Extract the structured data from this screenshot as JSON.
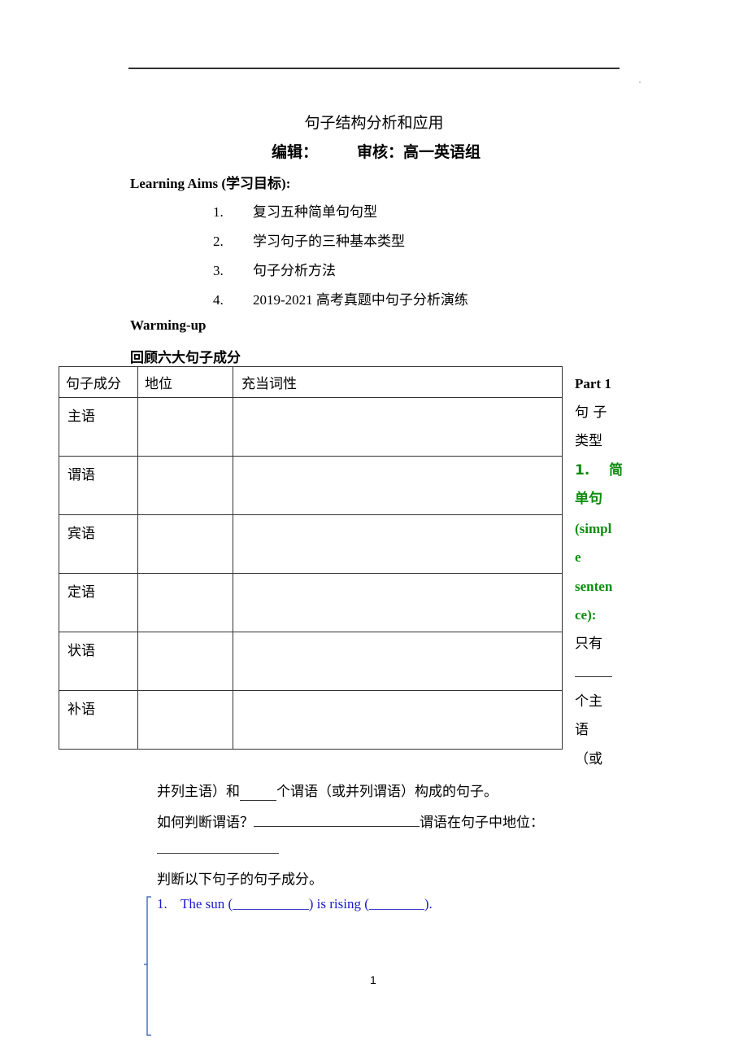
{
  "header": {
    "title": "句子结构分析和应用",
    "editor_label": "编辑：",
    "reviewer_label": "审核：高一英语组"
  },
  "learning_aims": {
    "heading": "Learning Aims (学习目标):",
    "items": [
      {
        "num": "1.",
        "text": "复习五种简单句句型"
      },
      {
        "num": "2.",
        "text": "学习句子的三种基本类型"
      },
      {
        "num": "3.",
        "text": "句子分析方法"
      },
      {
        "num": "4.",
        "text": "2019-2021 高考真题中句子分析演练"
      }
    ]
  },
  "warming_up": {
    "heading": "Warming-up",
    "subheading": "回顾六大句子成分"
  },
  "table": {
    "headers": [
      "句子成分",
      "地位",
      "充当词性"
    ],
    "rows": [
      {
        "component": "主语",
        "position": "",
        "pos": ""
      },
      {
        "component": "谓语",
        "position": "",
        "pos": ""
      },
      {
        "component": "宾语",
        "position": "",
        "pos": ""
      },
      {
        "component": "定语",
        "position": "",
        "pos": ""
      },
      {
        "component": "状语",
        "position": "",
        "pos": ""
      },
      {
        "component": "补语",
        "position": "",
        "pos": ""
      }
    ]
  },
  "sidebar": {
    "part": "Part 1",
    "part_title_1": "句 子",
    "part_title_2": "类型",
    "section_1": "1.    简",
    "section_2": "单句",
    "section_3": "(simpl",
    "section_4": "e",
    "section_5": "senten",
    "section_6": "ce):",
    "text_1": "只有",
    "text_2": "个主",
    "text_3": "语",
    "text_4": "（或",
    "accent_color": "#0c8c0c"
  },
  "body": {
    "line1_a": "并列主语）和",
    "line1_b": "个谓语（或并列谓语）构成的句子。",
    "line2_a": "如何判断谓语？",
    "line2_b": "谓语在句子中地位：",
    "line3": "判断以下句子的句子成分。"
  },
  "exercise": {
    "num": "1.",
    "part1": "The sun (",
    "part2": ") is rising (",
    "part3": ").",
    "blank1": "___________",
    "blank2": "________",
    "color": "#1a1acc"
  },
  "footer": {
    "page_number": "1"
  }
}
